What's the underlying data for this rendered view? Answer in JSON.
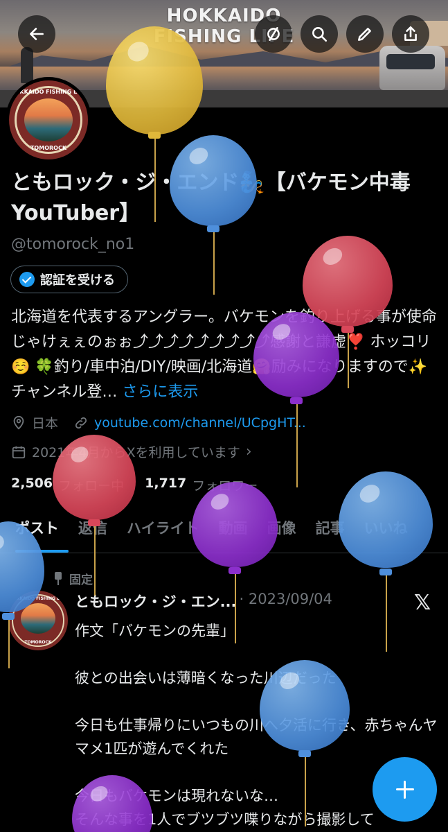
{
  "banner": {
    "title_line1": "HOKKAIDO",
    "title_line2": "FISHING LIFE"
  },
  "header_buttons": [
    "back-arrow-icon",
    "mute-icon",
    "search-icon",
    "edit-icon",
    "share-icon"
  ],
  "avatar": {
    "top_text": "HOKKAIDO FISHING LIFE",
    "bottom_text": "TOMOROCK"
  },
  "profile": {
    "name": "ともロック・ジ・エンド🧞【バケモン中毒 YouTuber】",
    "handle": "@tomorock_no1",
    "verify_label": "認証を受ける",
    "bio": "北海道を代表するアングラー。バケモンを釣り上げる事が使命じゃけぇぇのぉぉ⤴︎⤴︎⤴︎⤴︎⤴︎⤴︎⤴︎⤴︎⤴︎感謝と謙虚❣️ ホッコリ☺️ 🍀釣り/車中泊/DIY/映画/北海道🤗励みになりますので✨ チャンネル登…",
    "bio_more": "さらに表示",
    "location": "日本",
    "link": "youtube.com/channel/UCpgHT...",
    "joined": "2021年4月からXを利用しています",
    "following_count": "2,506",
    "following_label": "フォロー中",
    "followers_count": "1,717",
    "followers_label": "フォロワー"
  },
  "tabs": [
    "ポスト",
    "返信",
    "ハイライト",
    "動画",
    "画像",
    "記事",
    "いいね"
  ],
  "pinned_post": {
    "pinned_label": "固定",
    "author": "ともロック・ジ・エン...",
    "date": "· 2023/09/04",
    "text": "作文「バケモンの先輩」\n\n彼との出会いは薄暗くなった川辺だった\n\n今日も仕事帰りにいつもの川へ夕活に行き、赤ちゃんヤマメ1匹が遊んでくれた\n\n今日もバケモンは現れないな…\nそんな事を1人でブツブツ喋りながら撮影して"
  },
  "colors": {
    "accent": "#1d9bf0",
    "text_primary": "#e7e9ea",
    "text_secondary": "#71767b",
    "background": "#000000"
  }
}
